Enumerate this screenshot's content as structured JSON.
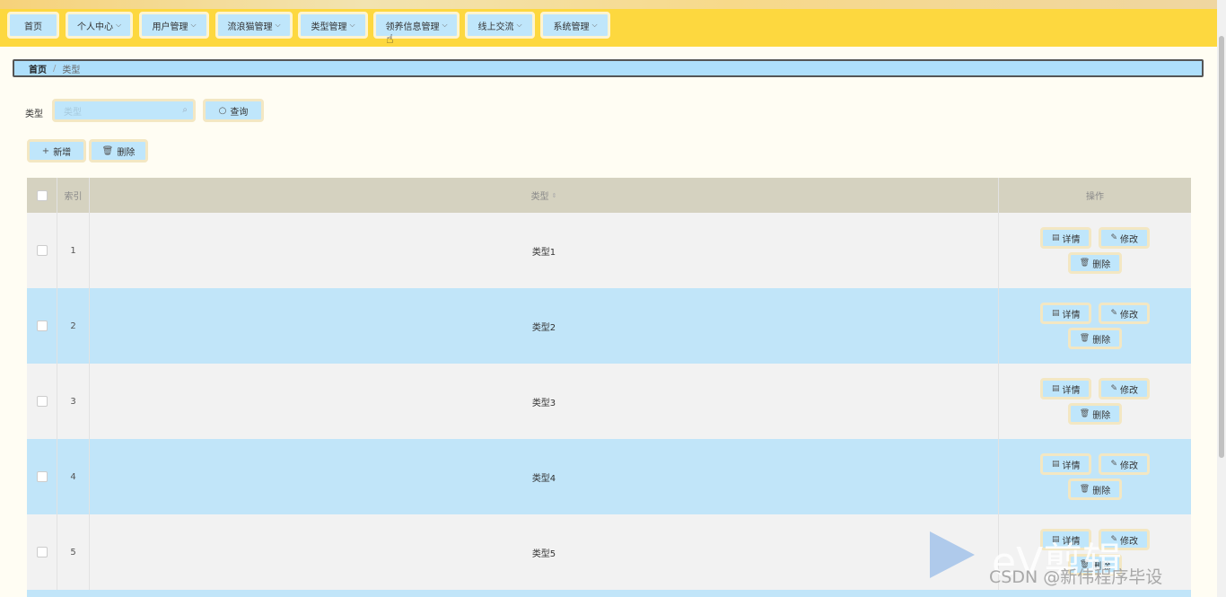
{
  "nav": {
    "items": [
      {
        "label": "首页",
        "dropdown": false
      },
      {
        "label": "个人中心",
        "dropdown": true
      },
      {
        "label": "用户管理",
        "dropdown": true
      },
      {
        "label": "流浪猫管理",
        "dropdown": true
      },
      {
        "label": "类型管理",
        "dropdown": true
      },
      {
        "label": "领养信息管理",
        "dropdown": true
      },
      {
        "label": "线上交流",
        "dropdown": true
      },
      {
        "label": "系统管理",
        "dropdown": true
      }
    ]
  },
  "breadcrumb": {
    "home": "首页",
    "separator": "/",
    "current": "类型"
  },
  "search": {
    "label": "类型",
    "placeholder": "类型",
    "button_label": "查询"
  },
  "actions": {
    "add_label": "新增",
    "delete_label": "删除"
  },
  "table": {
    "headers": {
      "index": "索引",
      "type": "类型",
      "ops": "操作"
    },
    "rows": [
      {
        "index": "1",
        "type": "类型1"
      },
      {
        "index": "2",
        "type": "类型2"
      },
      {
        "index": "3",
        "type": "类型3"
      },
      {
        "index": "4",
        "type": "类型4"
      },
      {
        "index": "5",
        "type": "类型5"
      }
    ],
    "row_buttons": {
      "detail": "详情",
      "edit": "修改",
      "delete": "删除"
    }
  },
  "watermark": {
    "logo": "eV剪辑",
    "text": "CSDN @新伟程序毕设"
  },
  "colors": {
    "navbar": "#fdd83f",
    "button": "#bfe6fb",
    "row_even": "#c1e5f9",
    "row_odd": "#f2f2f2",
    "header": "#d5d2c0"
  }
}
